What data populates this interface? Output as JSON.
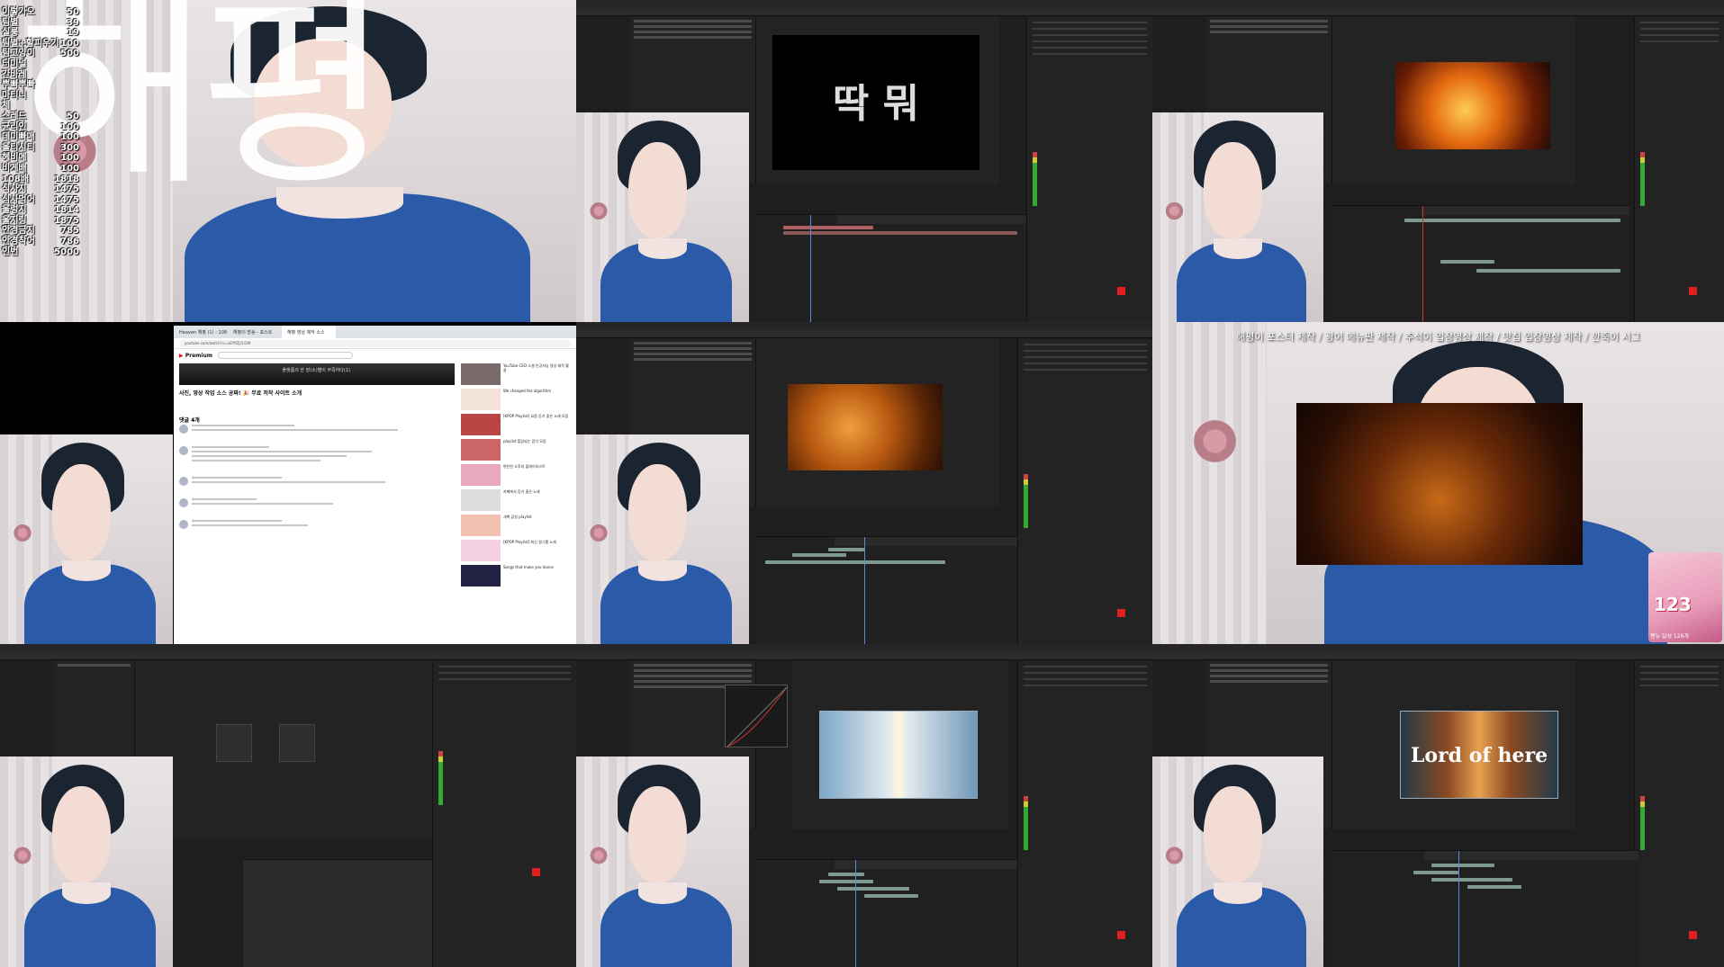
{
  "stats": [
    {
      "label": "이렇가오",
      "value": "50"
    },
    {
      "label": "팀별",
      "value": "39"
    },
    {
      "label": "실룽",
      "value": "19"
    },
    {
      "label": "팀별+할피우기",
      "value": "100"
    },
    {
      "label": "팀고양이",
      "value": "500"
    },
    {
      "label": "터미널",
      "value": ""
    },
    {
      "label": "간바레",
      "value": ""
    },
    {
      "label": "뿌빠뿌빠",
      "value": ""
    },
    {
      "label": "마티니",
      "value": ""
    },
    {
      "label": "체",
      "value": ""
    },
    {
      "label": "스레드",
      "value": "50"
    },
    {
      "label": "균리인",
      "value": "100"
    },
    {
      "label": "데미빠매",
      "value": "100"
    },
    {
      "label": "올티시티",
      "value": "300"
    },
    {
      "label": "헤비메",
      "value": "100"
    },
    {
      "label": "비게배",
      "value": "100"
    },
    {
      "label": "108배",
      "value": "1818"
    },
    {
      "label": "식사지",
      "value": "1475"
    },
    {
      "label": "식사먹어",
      "value": "1475"
    },
    {
      "label": "울렁지",
      "value": "1814"
    },
    {
      "label": "울지링",
      "value": "1875"
    },
    {
      "label": "안경금지",
      "value": "785"
    },
    {
      "label": "안경착어",
      "value": "786"
    },
    {
      "label": "인번",
      "value": "5000"
    }
  ],
  "cell1_overlay": "해평",
  "cell2_comp_text": "딱 뭐",
  "browser": {
    "tabs": [
      "Heaven 해평 (1) - 108",
      "해평이 방송 - 포스트",
      "해평 영상 제작 소스"
    ],
    "url": "youtube.com/watch?v=u0YPZJ2U1W",
    "logo_prefix": "▶",
    "logo_text": "Premium",
    "player_text": "플랫폼의 한 장(소)별이 부족하다(1).",
    "video_title": "사진, 영상 작업 소스 공짜! 🎉 무료 저작 사이트 소개",
    "comments_header": "댓글 4개",
    "recs": [
      "YouTube CEO 소셜 인공지능 영상 제작 활용",
      "We changed the algorithm",
      "[KPOP Playlist] 요즘 듣기 좋은 노래 모음",
      "playlist 힐링되는 음악 모음",
      "편안한 오후의 플레이리스트",
      "카페에서 듣기 좋은 노래",
      "새벽 감성 playlist",
      "[KPOP Playlist] 최신 걸그룹 노래",
      "Songs that make you dance"
    ]
  },
  "cell6": {
    "scroll_text": "해평이 포스터 제작 / 광어 메뉴판 제작 / 추석이 입장영상 제작 / 맛칩 입장영상 제작 / 깐죽이 시그",
    "sticker_number": "123",
    "sticker_caption": "팬뉴 달성 128개"
  },
  "cell9_comp_text": "Lord of here"
}
